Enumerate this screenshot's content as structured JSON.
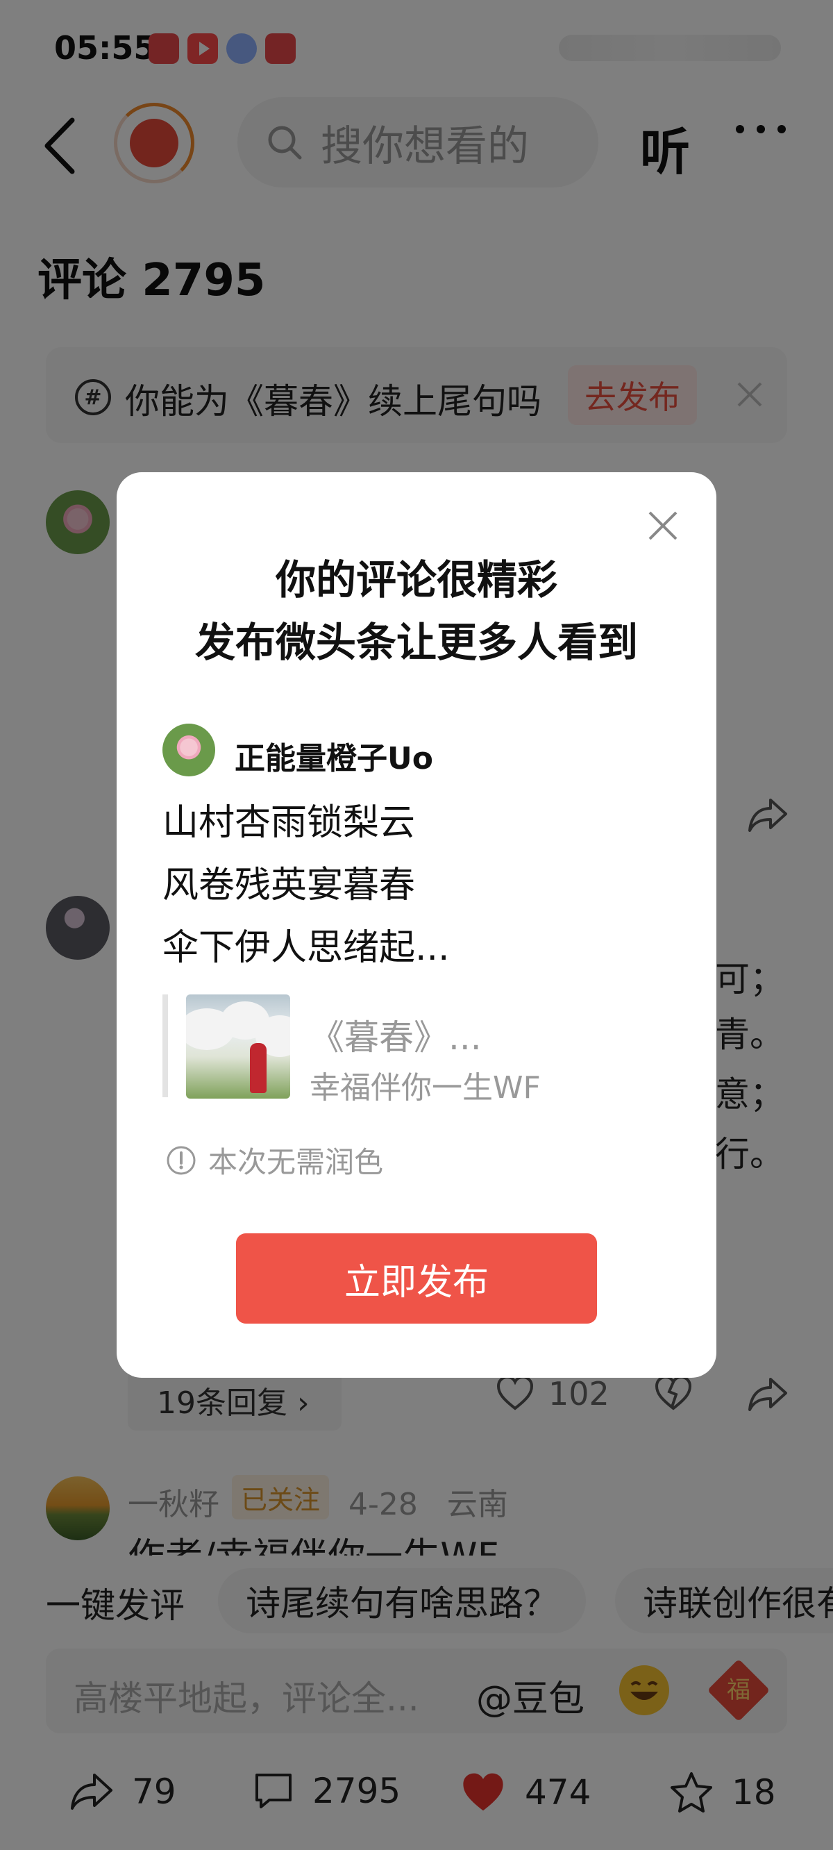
{
  "status_bar": {
    "time": "05:55"
  },
  "header": {
    "search_placeholder": "搜你想看的",
    "listen_label": "听"
  },
  "comments": {
    "title": "评论 2795",
    "topic": {
      "text": "你能为《暮春》续上尾句吗",
      "button": "去发布"
    },
    "side_text": [
      "可；",
      "青。",
      "意；",
      "行。"
    ],
    "replies": "19条回复 ›",
    "like_count": "102",
    "third": {
      "name": "一秋籽",
      "badge": "已关注",
      "date": "4-28",
      "location": "云南",
      "text": "作者/幸福伴你一生WF"
    }
  },
  "quick_reply": {
    "label": "一键发评",
    "chips": [
      "诗尾续句有啥思路？",
      "诗联创作很有"
    ]
  },
  "input": {
    "placeholder": "高楼平地起，评论全...",
    "at_label": "@豆包",
    "fu_char": "福"
  },
  "bottom_bar": {
    "share": "79",
    "comments": "2795",
    "likes": "474",
    "favorites": "18"
  },
  "modal": {
    "title_line1": "你的评论很精彩",
    "title_line2": "发布微头条让更多人看到",
    "user": "正能量橙子Uo",
    "poem": [
      "山村杏雨锁梨云",
      "风卷残英宴暮春",
      "伞下伊人思绪起..."
    ],
    "quote_title": "《暮春》...",
    "quote_author": "幸福伴你一生WF",
    "note": "本次无需润色",
    "button": "立即发布"
  },
  "colors": {
    "accent": "#ef5448",
    "overlay": "rgba(0,0,0,0.5)"
  }
}
